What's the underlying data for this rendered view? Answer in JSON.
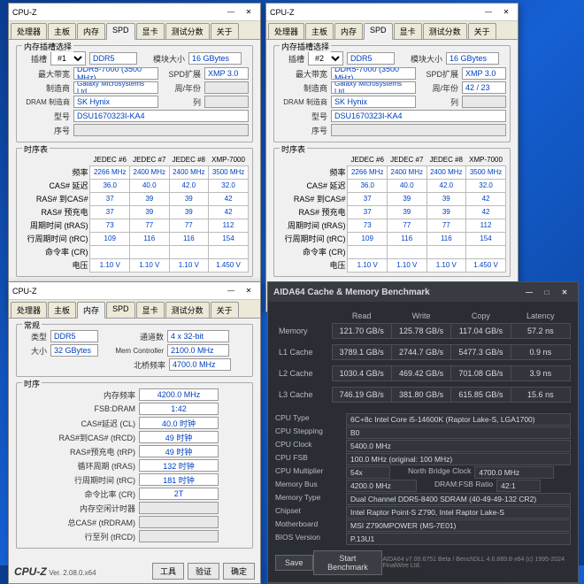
{
  "cpuz1": {
    "title": "CPU-Z",
    "tabs": [
      "处理器",
      "主板",
      "内存",
      "SPD",
      "显卡",
      "测试分数",
      "关于"
    ],
    "active": 3,
    "slot_label": "内存插槽选择",
    "slot_lbl": "插槽",
    "slot": "#1",
    "type": "DDR5",
    "mod_lbl": "模块大小",
    "mod": "16 GBytes",
    "bw_lbl": "最大带宽",
    "bw": "DDR5-7000 (3500 MHz)",
    "ext_lbl": "SPD扩展",
    "ext": "XMP 3.0",
    "mfg_lbl": "制造商",
    "mfg": "Galaxy Microsystems Ltd.",
    "wk_lbl": "周/年份",
    "wk": "",
    "dram_lbl": "DRAM 制造商",
    "dram": "SK Hynix",
    "rank_lbl": "列",
    "rank": "",
    "pn_lbl": "型号",
    "pn": "DSU1670323I-KA4",
    "sn_lbl": "序号",
    "sn": "",
    "tt_lbl": "时序表",
    "cols": [
      "",
      "JEDEC #6",
      "JEDEC #7",
      "JEDEC #8",
      "XMP-7000"
    ],
    "rows": [
      [
        "频率",
        "2266 MHz",
        "2400 MHz",
        "2400 MHz",
        "3500 MHz"
      ],
      [
        "CAS# 延迟",
        "36.0",
        "40.0",
        "42.0",
        "32.0"
      ],
      [
        "RAS# 到CAS#",
        "37",
        "39",
        "39",
        "42"
      ],
      [
        "RAS# 预充电",
        "37",
        "39",
        "39",
        "42"
      ],
      [
        "周期时间 (tRAS)",
        "73",
        "77",
        "77",
        "112"
      ],
      [
        "行周期时间 (tRC)",
        "109",
        "116",
        "116",
        "154"
      ],
      [
        "命令率 (CR)",
        "",
        "",
        "",
        ""
      ],
      [
        "电压",
        "1.10 V",
        "1.10 V",
        "1.10 V",
        "1.450 V"
      ]
    ],
    "logo": "CPU-Z",
    "ver": "Ver. 2.08.0.x64",
    "btn_tool": "工具",
    "btn_val": "验证",
    "btn_ok": "确定"
  },
  "cpuz2": {
    "title": "CPU-Z",
    "slot": "#2",
    "type": "DDR5",
    "mod": "16 GBytes",
    "bw": "DDR5-7000 (3500 MHz)",
    "ext": "XMP 3.0",
    "mfg": "Galaxy Microsystems Ltd.",
    "wk": "42 / 23",
    "dram": "SK Hynix",
    "rank": "",
    "pn": "DSU1670323I-KA4",
    "sn": ""
  },
  "cpuz3": {
    "title": "CPU-Z",
    "tabs": [
      "处理器",
      "主板",
      "内存",
      "SPD",
      "显卡",
      "测试分数",
      "关于"
    ],
    "active": 2,
    "gen_lbl": "常规",
    "type_lbl": "类型",
    "type": "DDR5",
    "ch_lbl": "通道数",
    "ch": "4 x 32-bit",
    "size_lbl": "大小",
    "size": "32 GBytes",
    "mc_lbl": "Mem Controller",
    "mc": "2100.0 MHz",
    "nb_lbl": "北桥频率",
    "nb": "4700.0 MHz",
    "tim_lbl": "时序",
    "rows": [
      [
        "内存频率",
        "4200.0 MHz"
      ],
      [
        "FSB:DRAM",
        "1:42"
      ],
      [
        "CAS#延迟 (CL)",
        "40.0 时钟"
      ],
      [
        "RAS#到CAS# (tRCD)",
        "49 时钟"
      ],
      [
        "RAS#预充电 (tRP)",
        "49 时钟"
      ],
      [
        "循环周期 (tRAS)",
        "132 时钟"
      ],
      [
        "行周期时间 (tRC)",
        "181 时钟"
      ],
      [
        "命令比率 (CR)",
        "2T"
      ],
      [
        "内存空闲计时器",
        ""
      ],
      [
        "总CAS# (tRDRAM)",
        ""
      ],
      [
        "行至列 (tRCD)",
        ""
      ]
    ]
  },
  "aida": {
    "title": "AIDA64 Cache & Memory Benchmark",
    "cols": [
      "",
      "Read",
      "Write",
      "Copy",
      "Latency"
    ],
    "rows": [
      [
        "Memory",
        "121.70 GB/s",
        "125.78 GB/s",
        "117.04 GB/s",
        "57.2 ns"
      ],
      [
        "L1 Cache",
        "3789.1 GB/s",
        "2744.7 GB/s",
        "5477.3 GB/s",
        "0.9 ns"
      ],
      [
        "L2 Cache",
        "1030.4 GB/s",
        "469.42 GB/s",
        "701.08 GB/s",
        "3.9 ns"
      ],
      [
        "L3 Cache",
        "746.19 GB/s",
        "381.80 GB/s",
        "615.85 GB/s",
        "15.6 ns"
      ]
    ],
    "info": [
      [
        "CPU Type",
        "6C+8c Intel Core i5-14600K (Raptor Lake-S, LGA1700)"
      ],
      [
        "CPU Stepping",
        "B0"
      ],
      [
        "CPU Clock",
        "5400.0 MHz"
      ],
      [
        "CPU FSB",
        "100.0 MHz   (original: 100 MHz)"
      ]
    ],
    "mult_lbl": "CPU Multiplier",
    "mult": "54x",
    "nbc_lbl": "North Bridge Clock",
    "nbc": "4700.0 MHz",
    "mb_lbl": "Memory Bus",
    "mb": "4200.0 MHz",
    "dfr_lbl": "DRAM:FSB Ratio",
    "dfr": "42:1",
    "info2": [
      [
        "Memory Type",
        "Dual Channel DDR5-8400 SDRAM  (40-49-49-132 CR2)"
      ],
      [
        "Chipset",
        "Intel Raptor Point-S Z790, Intel Raptor Lake-S"
      ],
      [
        "Motherboard",
        "MSI Z790MPOWER (MS-7E01)"
      ],
      [
        "BIOS Version",
        "P.13U1"
      ]
    ],
    "save": "Save",
    "start": "Start Benchmark",
    "cp": "AIDA64 v7.00.6751 Beta / BenchDLL 4.6.889.8-x64  (c) 1995-2024 FinalWire Ltd."
  }
}
